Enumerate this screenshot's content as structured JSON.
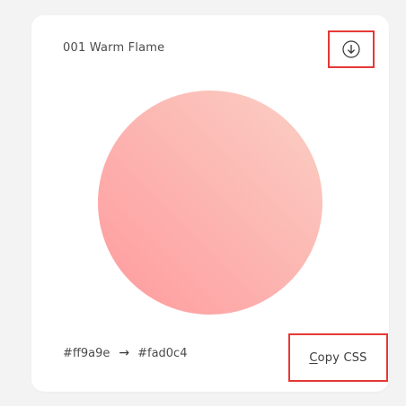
{
  "gradient": {
    "title": "001 Warm Flame",
    "start_color": "#ff9a9e",
    "end_color": "#fad0c4",
    "start_label": "#ff9a9e",
    "end_label": "#fad0c4",
    "arrow": "→"
  },
  "actions": {
    "download_icon": "download-circle-icon",
    "copy_label_first": "C",
    "copy_label_rest": "opy CSS"
  },
  "colors": {
    "page_background": "#f3f3f3",
    "card_background": "#ffffff",
    "highlight_border": "#e53935"
  }
}
